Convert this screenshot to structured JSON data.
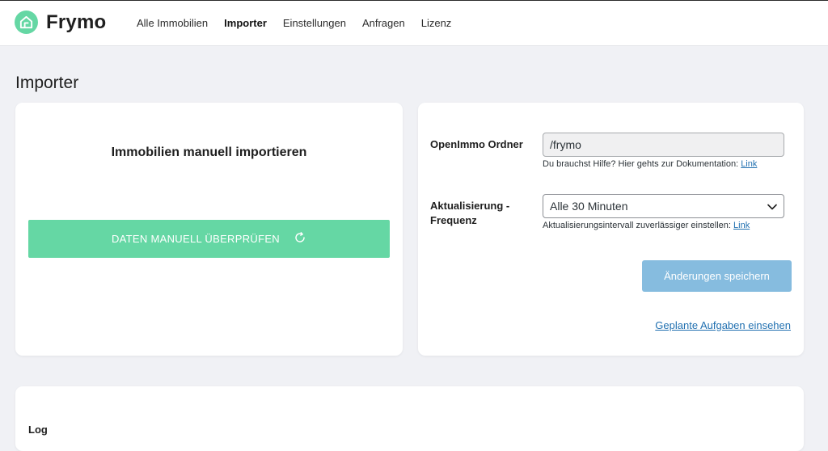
{
  "header": {
    "brand": "Frymo",
    "nav": [
      {
        "label": "Alle Immobilien",
        "active": false
      },
      {
        "label": "Importer",
        "active": true
      },
      {
        "label": "Einstellungen",
        "active": false
      },
      {
        "label": "Anfragen",
        "active": false
      },
      {
        "label": "Lizenz",
        "active": false
      }
    ]
  },
  "page": {
    "title": "Importer"
  },
  "manual_import": {
    "title": "Immobilien manuell importieren",
    "button_label": "DATEN MANUELL ÜBERPRÜFEN"
  },
  "settings": {
    "folder_label": "OpenImmo Ordner",
    "folder_value": "/frymo",
    "folder_help": "Du brauchst Hilfe? Hier gehts zur Dokumentation:",
    "folder_help_link": "Link",
    "frequency_label": "Aktualisierung - Frequenz",
    "frequency_value": "Alle 30 Minuten",
    "frequency_help": "Aktualisierungsintervall zuverlässiger einstellen:",
    "frequency_help_link": "Link",
    "save_label": "Änderungen speichern",
    "tasks_link": "Geplante Aufgaben einsehen"
  },
  "log": {
    "title": "Log"
  },
  "colors": {
    "accent_green": "#65d7a4",
    "save_blue": "#86bcdf",
    "link_blue": "#2271b1",
    "background": "#f0f1f5"
  },
  "icons": {
    "logo": "house-icon",
    "refresh": "refresh-icon",
    "dropdown": "chevron-down-icon"
  }
}
